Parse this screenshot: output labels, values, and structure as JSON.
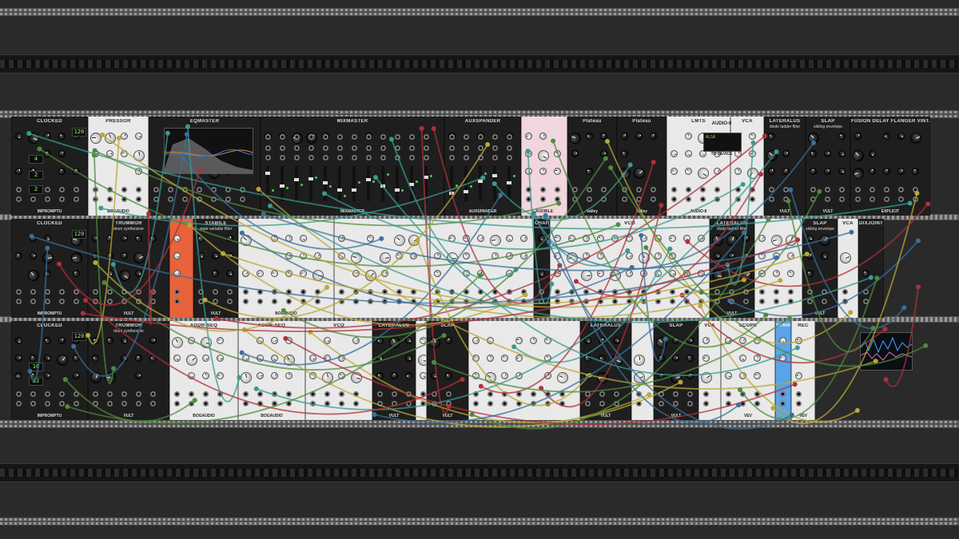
{
  "rack": {
    "rows": [
      {
        "name": "row-1",
        "modules": [
          {
            "id": "clocked-1",
            "title": "CLOCKED",
            "footer": "IMPROMPTU",
            "theme": "dark",
            "width": 96
          },
          {
            "id": "pressor",
            "title": "PRESSOR",
            "footer": "BOGAUDIO",
            "theme": "light",
            "width": 76
          },
          {
            "id": "eqmaster",
            "title": "EQMASTER",
            "footer": "",
            "theme": "dark",
            "width": 140
          },
          {
            "id": "mixmaster",
            "title": "MIXMASTER",
            "footer": "MIXMASTER",
            "theme": "dark",
            "width": 230
          },
          {
            "id": "auxspander",
            "title": "AUXSPANDER",
            "footer": "AUXSPANDER",
            "theme": "dark",
            "width": 96
          },
          {
            "id": "audible-pink",
            "title": "",
            "footer": "AUDIBLE",
            "theme": "pink",
            "width": 58
          },
          {
            "id": "plateau-1",
            "title": "Plateau",
            "footer": "Valley",
            "theme": "dark",
            "width": 62
          },
          {
            "id": "plateau-2",
            "title": "Plateau",
            "footer": "Valley",
            "theme": "dark",
            "width": 62
          },
          {
            "id": "lmt-audio8",
            "title": "LMTS",
            "footer": "AUDIO-8",
            "theme": "light",
            "width": 80
          },
          {
            "id": "vca-1",
            "title": "VCA",
            "footer": "",
            "theme": "light",
            "width": 42
          },
          {
            "id": "lateralus-1",
            "title": "LATERALUS",
            "subtitle": "diode ladder filter",
            "footer": "VULT",
            "theme": "dark",
            "width": 52
          },
          {
            "id": "slap-1",
            "title": "SLAP",
            "subtitle": "sliding envelope",
            "footer": "VULT",
            "theme": "dark",
            "width": 56
          },
          {
            "id": "chorus-1",
            "title": "FUSION DELAY FLANGER VINTAGE ENSEMBLE",
            "footer": "EXPLICIT",
            "theme": "dark",
            "width": 100
          }
        ]
      },
      {
        "name": "row-2",
        "modules": [
          {
            "id": "clocked-2",
            "title": "CLOCKED",
            "footer": "IMPROMPTU",
            "theme": "dark",
            "width": 96
          },
          {
            "id": "trummor-1",
            "title": "TRUMMOR",
            "subtitle": "drum synthesizer",
            "footer": "VULT",
            "theme": "dark",
            "width": 102
          },
          {
            "id": "orange-mod",
            "title": "",
            "footer": "",
            "theme": "orange",
            "width": 30
          },
          {
            "id": "stabile",
            "title": "STABILE",
            "subtitle": "state variable filter",
            "footer": "VULT",
            "theme": "dark",
            "width": 56
          },
          {
            "id": "bog-vco-1",
            "title": "",
            "footer": "BOGAUDIO",
            "theme": "light",
            "width": 120
          },
          {
            "id": "bog-vco-2",
            "title": "",
            "footer": "",
            "theme": "light",
            "width": 120
          },
          {
            "id": "bog-vco-3",
            "title": "",
            "footer": "",
            "theme": "light",
            "width": 130
          },
          {
            "id": "chances",
            "title": "CHANCES",
            "footer": "",
            "theme": "dark",
            "width": 20
          },
          {
            "id": "vco-big",
            "title": "VCO",
            "footer": "",
            "theme": "light",
            "width": 200
          },
          {
            "id": "lateralus-2",
            "title": "LATERALUS",
            "subtitle": "diode ladder filter",
            "footer": "VULT",
            "theme": "dark",
            "width": 56
          },
          {
            "id": "mix-light-2",
            "title": "",
            "footer": "",
            "theme": "light",
            "width": 60
          },
          {
            "id": "slap-2",
            "title": "SLAP",
            "subtitle": "sliding envelope",
            "footer": "VULT",
            "theme": "dark",
            "width": 44
          },
          {
            "id": "vca-2",
            "title": "VCA",
            "footer": "",
            "theme": "light",
            "width": 26
          },
          {
            "id": "dixjoint",
            "title": "DIXJOINT",
            "footer": "",
            "theme": "dark",
            "width": 32
          }
        ]
      },
      {
        "name": "row-3",
        "modules": [
          {
            "id": "clocked-3",
            "title": "CLOCKED",
            "footer": "IMPROMPTU",
            "theme": "dark",
            "width": 96
          },
          {
            "id": "trummor-2",
            "title": "TRUMMOR",
            "subtitle": "drum synthesizer",
            "footer": "VULT",
            "theme": "dark",
            "width": 102
          },
          {
            "id": "addr-seq-1",
            "title": "ADDR-SEQ",
            "footer": "BOGAUDIO",
            "theme": "light",
            "width": 86
          },
          {
            "id": "addr-seq-2",
            "title": "ADDR-SEQ",
            "footer": "BOGAUDIO",
            "theme": "light",
            "width": 84
          },
          {
            "id": "vco-r3",
            "title": "VCO",
            "footer": "",
            "theme": "light",
            "width": 84
          },
          {
            "id": "lateralus-3",
            "title": "LATERALUS",
            "footer": "VULT",
            "theme": "dark",
            "width": 54
          },
          {
            "id": "vca-r3",
            "title": "VCA",
            "footer": "",
            "theme": "light",
            "width": 14
          },
          {
            "id": "slap-3",
            "title": "SLAP",
            "footer": "VULT",
            "theme": "dark",
            "width": 52
          },
          {
            "id": "mix-light-3",
            "title": "",
            "footer": "",
            "theme": "light",
            "width": 140
          },
          {
            "id": "lateralus-4",
            "title": "LATERALUS",
            "footer": "VULT",
            "theme": "dark",
            "width": 64
          },
          {
            "id": "vca-r3b",
            "title": "",
            "footer": "",
            "theme": "light",
            "width": 28
          },
          {
            "id": "slap-4",
            "title": "SLAP",
            "footer": "VULT",
            "theme": "dark",
            "width": 56
          },
          {
            "id": "vca-3",
            "title": "VCA",
            "footer": "",
            "theme": "light",
            "width": 28
          },
          {
            "id": "scope",
            "title": "SCOPE",
            "footer": "VEV",
            "theme": "light",
            "width": 68
          },
          {
            "id": "strip",
            "title": "STRIP",
            "footer": "",
            "theme": "blue",
            "width": 20
          },
          {
            "id": "rec",
            "title": "REC",
            "footer": "VEV",
            "theme": "light",
            "width": 30
          }
        ]
      }
    ]
  },
  "labels": {
    "clock_bpm": "120",
    "clock_ratio_a": "4",
    "clock_ratio_b": "2",
    "clock_ratio_c": "2",
    "clocked2_bpm": "120",
    "clocked3_bpm": "120",
    "clocked3_a": "16",
    "clocked3_b": "32",
    "audio8_label": "AUDIO-8",
    "audio8_device": "TO DEVICE",
    "audio8_screen": "ALSA"
  },
  "colors": {
    "dark_panel": "#1e1e1e",
    "light_panel": "#e9e9e9",
    "pink_panel": "#f1d6de",
    "orange_panel": "#e8623a",
    "blue_panel": "#5aa4e8",
    "cable_red": "#b0303a",
    "cable_green": "#4e8b3a",
    "cable_blue": "#3a6f9a",
    "cable_yellow": "#b8a836",
    "cable_teal": "#3a9a8f"
  }
}
